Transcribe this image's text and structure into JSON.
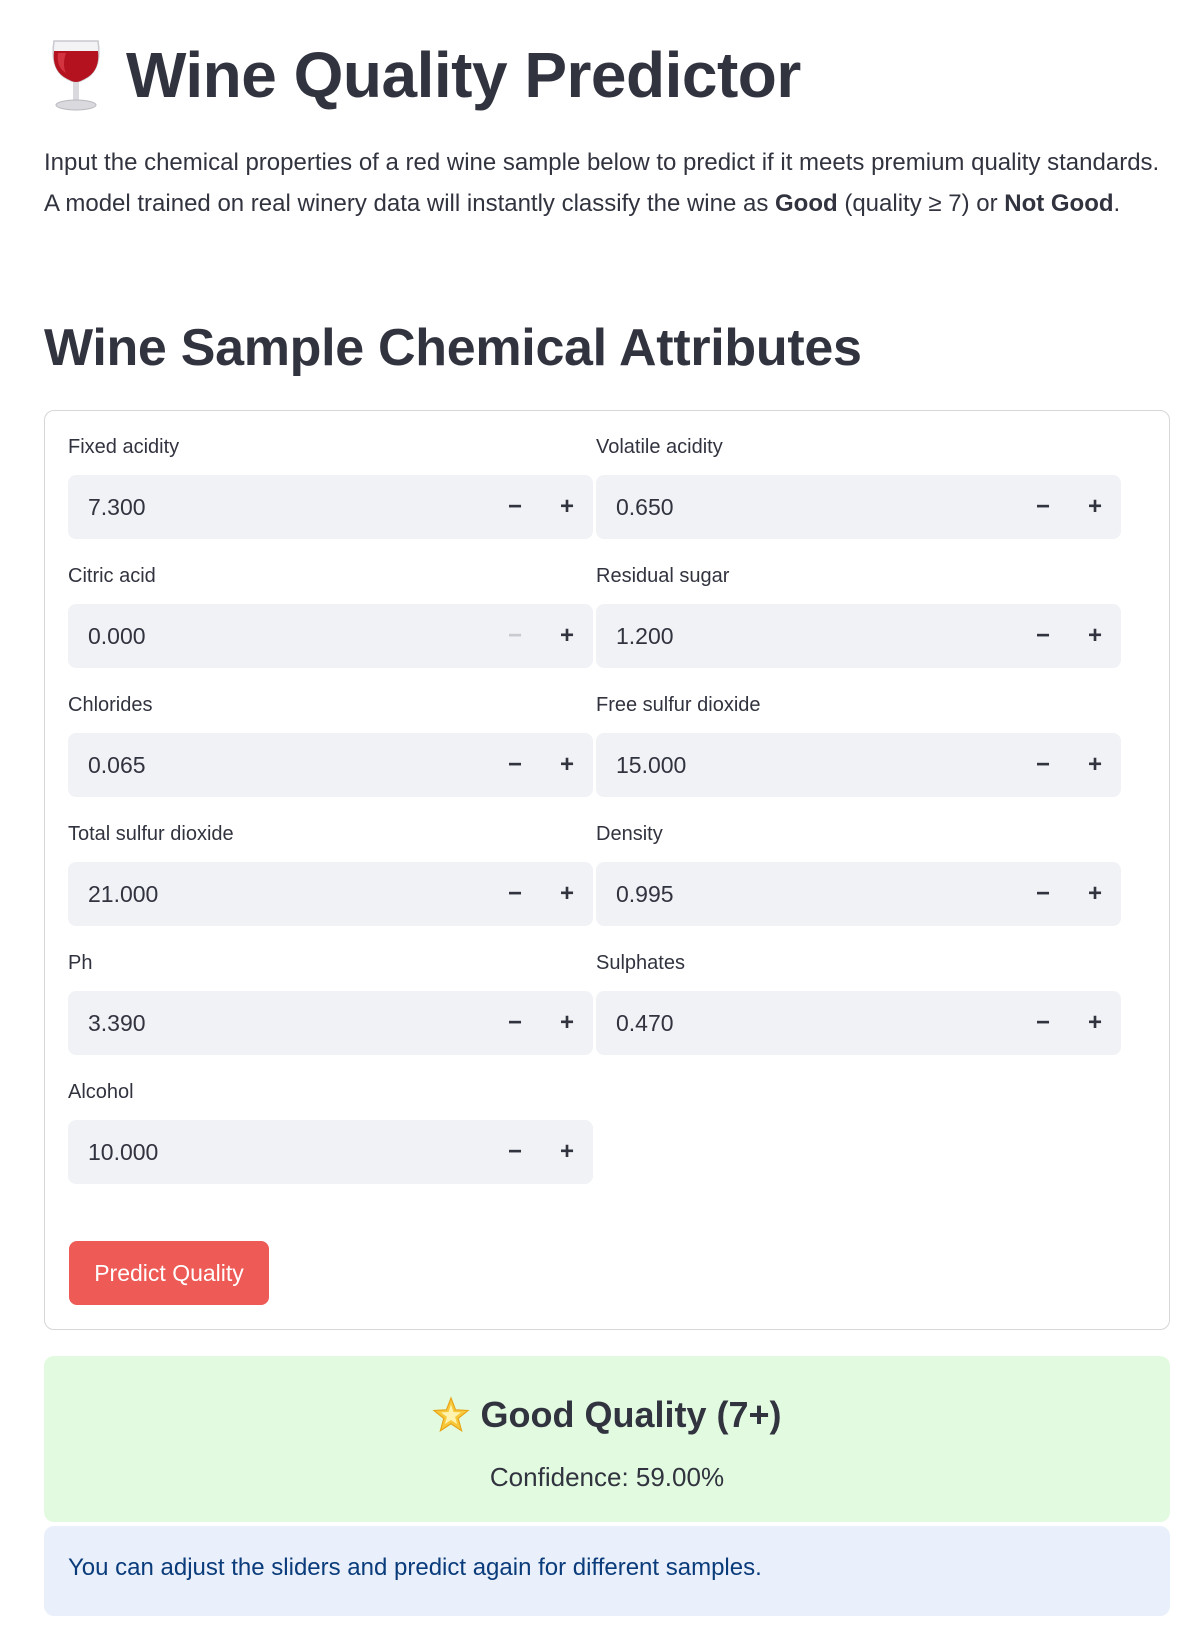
{
  "header": {
    "title": "Wine Quality Predictor",
    "title_icon": "wine-glass-icon"
  },
  "intro": {
    "part1": "Input the chemical properties of a red wine sample below to predict if it meets premium quality standards. A model trained on real winery data will instantly classify the wine as ",
    "good_bold": "Good",
    "part2": " (quality ≥ 7) or ",
    "not_good_bold": "Not Good",
    "part3": "."
  },
  "section": {
    "title": "Wine Sample Chemical Attributes"
  },
  "fields": [
    {
      "label": "Fixed acidity",
      "value": "7.300",
      "minus_disabled": false
    },
    {
      "label": "Volatile acidity",
      "value": "0.650",
      "minus_disabled": false
    },
    {
      "label": "Citric acid",
      "value": "0.000",
      "minus_disabled": true
    },
    {
      "label": "Residual sugar",
      "value": "1.200",
      "minus_disabled": false
    },
    {
      "label": "Chlorides",
      "value": "0.065",
      "minus_disabled": false
    },
    {
      "label": "Free sulfur dioxide",
      "value": "15.000",
      "minus_disabled": false
    },
    {
      "label": "Total sulfur dioxide",
      "value": "21.000",
      "minus_disabled": false
    },
    {
      "label": "Density",
      "value": "0.995",
      "minus_disabled": false
    },
    {
      "label": "Ph",
      "value": "3.390",
      "minus_disabled": false
    },
    {
      "label": "Sulphates",
      "value": "0.470",
      "minus_disabled": false
    },
    {
      "label": "Alcohol",
      "value": "10.000",
      "minus_disabled": false
    }
  ],
  "stepper": {
    "minus_symbol": "−",
    "plus_symbol": "+"
  },
  "predict_button": {
    "label": "Predict Quality",
    "color": "#ee5a55"
  },
  "result": {
    "icon": "star-icon",
    "heading": "Good Quality (7+)",
    "confidence": "Confidence: 59.00%",
    "background": "#e2fbe0"
  },
  "info": {
    "message": "You can adjust the sliders and predict again for different samples.",
    "background": "#e9f0fb"
  }
}
